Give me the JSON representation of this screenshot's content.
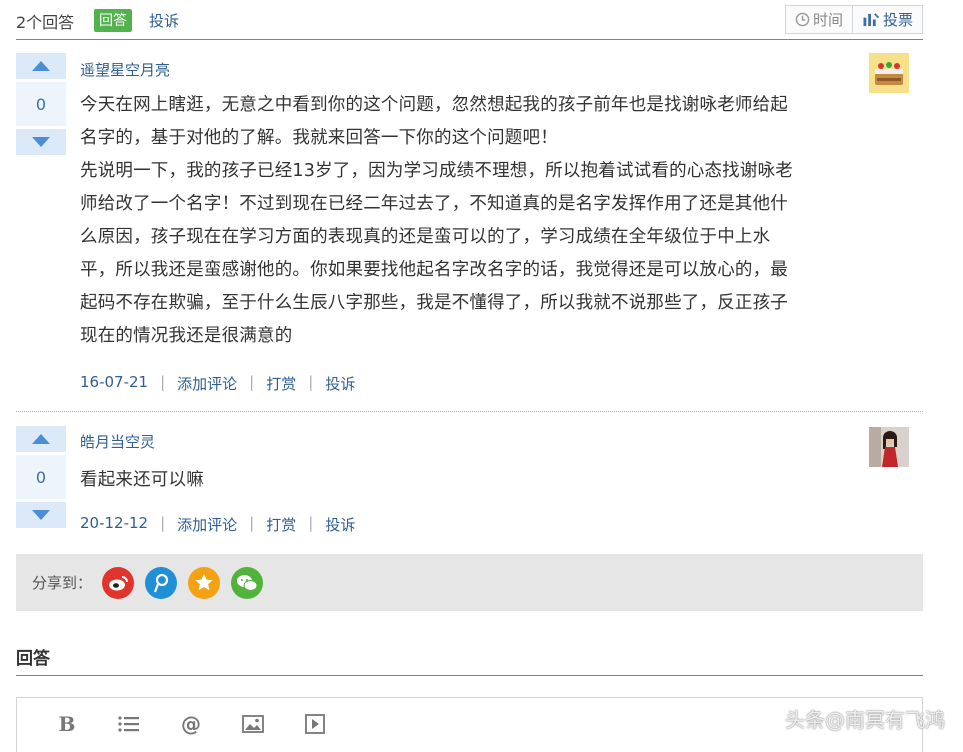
{
  "header": {
    "answer_count": "2个回答",
    "answer_tag": "回答",
    "report": "投诉",
    "sort_time": "时间",
    "sort_vote": "投票"
  },
  "answers": [
    {
      "author": "遥望星空月亮",
      "votes": "0",
      "lines": [
        "今天在网上瞎逛，无意之中看到你的这个问题，忽然想起我的孩子前年也是找谢咏老师给起",
        "名字的，基于对他的了解。我就来回答一下你的这个问题吧！",
        "先说明一下，我的孩子已经13岁了，因为学习成绩不理想，所以抱着试试看的心态找谢咏老",
        "师给改了一个名字！不过到现在已经二年过去了，不知道真的是名字发挥作用了还是其他什",
        "么原因，孩子现在在学习方面的表现真的还是蛮可以的了，学习成绩在全年级位于中上水",
        "平，所以我还是蛮感谢他的。你如果要找他起名字改名字的话，我觉得还是可以放心的，最",
        "起码不存在欺骗，至于什么生辰八字那些，我是不懂得了，所以我就不说那些了，反正孩子",
        "现在的情况我还是很满意的"
      ],
      "date": "16-07-21",
      "comment": "添加评论",
      "reward": "打赏",
      "report": "投诉"
    },
    {
      "author": "皓月当空灵",
      "votes": "0",
      "lines": [
        "看起来还可以嘛"
      ],
      "date": "20-12-12",
      "comment": "添加评论",
      "reward": "打赏",
      "report": "投诉"
    }
  ],
  "share": {
    "label": "分享到：",
    "icons": [
      "weibo-icon",
      "tencent-weibo-icon",
      "qzone-icon",
      "wechat-icon"
    ],
    "colors": [
      "#e0342c",
      "#1f8fd6",
      "#f4a114",
      "#51b33c"
    ]
  },
  "reply": {
    "title": "回答",
    "toolbar": {
      "bold": "B",
      "at": "@"
    }
  },
  "watermark": "头条@南冥有飞鸿"
}
